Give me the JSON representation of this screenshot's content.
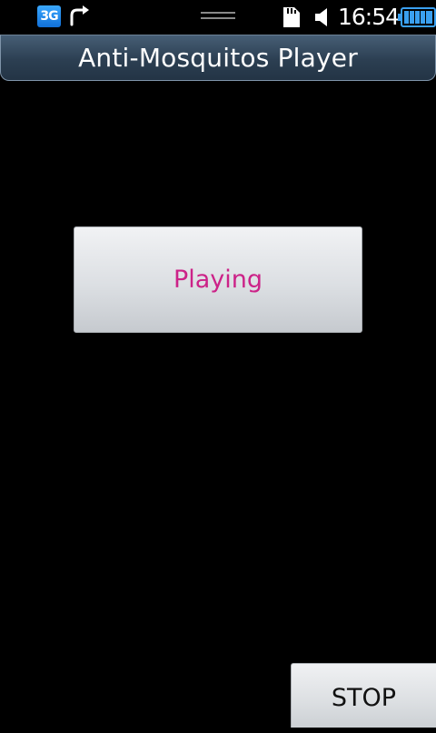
{
  "status_bar": {
    "network_label": "3G",
    "time": "16:54",
    "icons": [
      "network-3g-icon",
      "sync-icon",
      "drag-handle-icon",
      "sd-card-icon",
      "speaker-icon",
      "battery-icon"
    ]
  },
  "title_bar": {
    "title": "Anti-Mosquitos Player"
  },
  "main": {
    "status_label": "Playing",
    "status_color": "#cc2288"
  },
  "controls": {
    "stop_label": "STOP"
  },
  "colors": {
    "background": "#000000",
    "title_bar": "#2c3f52",
    "accent": "#cc2288"
  }
}
